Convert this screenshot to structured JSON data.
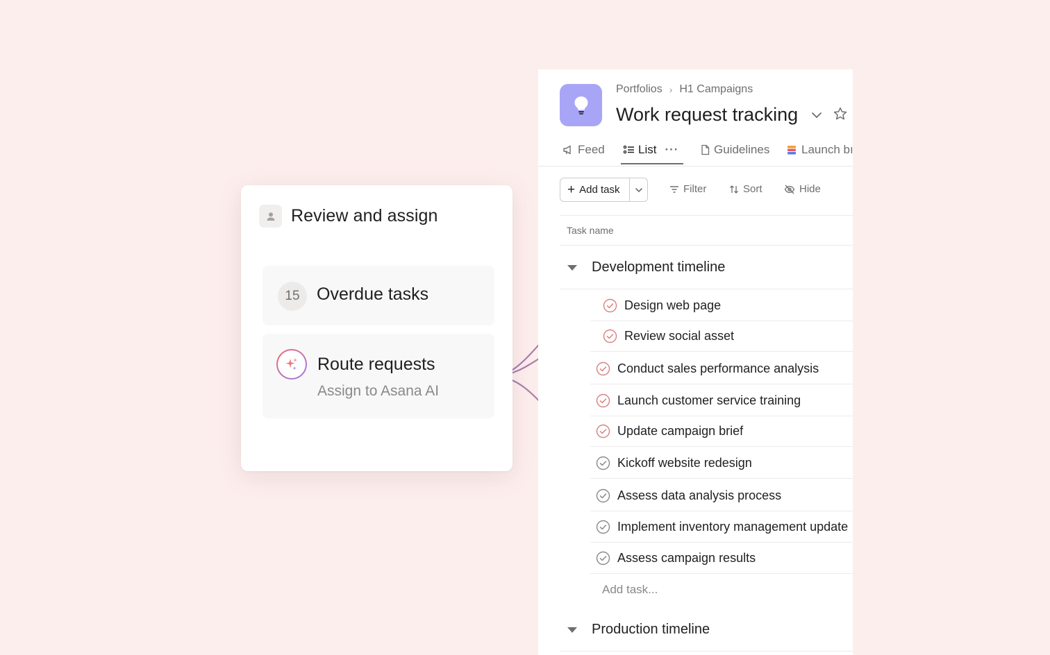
{
  "colors": {
    "background": "#fdeeee",
    "accent_coral": "#f06a6a",
    "accent_purple": "#9b7cf0",
    "project_icon": "#a8a5f7",
    "line_purple": "#8f7fc7",
    "line_coral": "#d9826f"
  },
  "assign_card": {
    "header_icon": "person-icon",
    "title": "Review and assign",
    "overdue": {
      "count": "15",
      "label": "Overdue tasks"
    },
    "route": {
      "icon": "sparkle-icon",
      "label": "Route requests",
      "sub": "Assign to Asana AI"
    }
  },
  "project": {
    "icon": "lightbulb-icon",
    "breadcrumb": [
      "Portfolios",
      "H1 Campaigns"
    ],
    "title": "Work request tracking",
    "tabs": [
      {
        "label": "Feed",
        "icon": "megaphone-icon"
      },
      {
        "label": "List",
        "icon": "list-icon",
        "more": "···"
      },
      {
        "label": "Guidelines",
        "icon": "document-icon"
      },
      {
        "label": "Launch bı",
        "icon": "launch-icon"
      }
    ],
    "toolbar": {
      "add_task": "Add task",
      "filter": "Filter",
      "sort": "Sort",
      "hide": "Hide"
    },
    "column_header": "Task name",
    "sections": [
      {
        "title": "Development timeline",
        "tasks": [
          "Design web page",
          "Review social asset",
          "Conduct sales performance analysis",
          "Launch customer service training",
          "Update campaign brief",
          "Kickoff website redesign",
          "Assess data analysis process",
          "Implement inventory management update",
          "Assess campaign results"
        ],
        "add_task_placeholder": "Add task..."
      },
      {
        "title": "Production timeline"
      }
    ]
  }
}
